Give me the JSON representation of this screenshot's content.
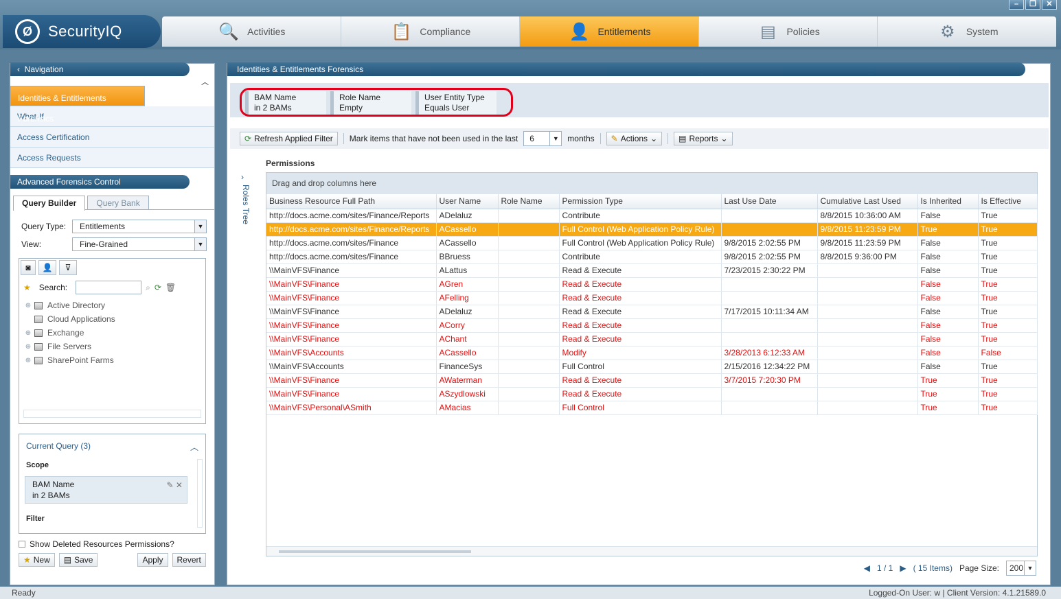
{
  "app": {
    "name": "SecurityIQ",
    "logo_letter": "Ø"
  },
  "window_controls": [
    "–",
    "❐",
    "✕"
  ],
  "tabs": [
    {
      "label": "Activities",
      "icon": "magnifier-icon"
    },
    {
      "label": "Compliance",
      "icon": "clipboard-icon"
    },
    {
      "label": "Entitlements",
      "icon": "user-icon",
      "active": true
    },
    {
      "label": "Policies",
      "icon": "policy-icon"
    },
    {
      "label": "System",
      "icon": "gear-icon"
    }
  ],
  "navigation": {
    "title": "Navigation",
    "items": [
      "Identities & Entitlements Forensics",
      "What-If",
      "Access Certification",
      "Access Requests"
    ],
    "selected_index": 0
  },
  "forensics": {
    "title": "Advanced Forensics Control",
    "tabs": [
      "Query Builder",
      "Query Bank"
    ],
    "query_type_label": "Query Type:",
    "query_type_value": "Entitlements",
    "view_label": "View:",
    "view_value": "Fine-Grained",
    "search_label": "Search:",
    "tree": [
      "Active Directory",
      "Cloud Applications",
      "Exchange",
      "File Servers",
      "SharePoint Farms"
    ],
    "current_query_label": "Current Query (3)",
    "scope_label": "Scope",
    "scope_chip_line1": "BAM Name",
    "scope_chip_line2": "in 2 BAMs",
    "filter_label": "Filter",
    "show_deleted_label": "Show Deleted Resources Permissions?",
    "buttons": {
      "new": "New",
      "save": "Save",
      "apply": "Apply",
      "revert": "Revert"
    }
  },
  "main": {
    "title": "Identities & Entitlements Forensics",
    "chips": [
      {
        "line1": "BAM Name",
        "line2": "in 2 BAMs"
      },
      {
        "line1": "Role Name",
        "line2": "Empty"
      },
      {
        "line1": "User Entity Type",
        "line2": "Equals  User"
      }
    ],
    "refresh_label": "Refresh Applied Filter",
    "mark_label": "Mark items that have not been used in the last",
    "months_value": "6",
    "months_label": "months",
    "actions_label": "Actions",
    "reports_label": "Reports",
    "roles_tree_label": "Roles Tree",
    "permissions_title": "Permissions",
    "drag_hint": "Drag and drop columns here",
    "columns": [
      "Business Resource Full Path",
      "User Name",
      "Role Name",
      "Permission Type",
      "Last Use Date",
      "Cumulative Last Used",
      "Is Inherited",
      "Is Effective"
    ],
    "rows": [
      {
        "style": "normal",
        "cells": [
          "http://docs.acme.com/sites/Finance/Reports",
          "ADelaluz",
          "",
          "Contribute",
          "",
          "8/8/2015 10:36:00 AM",
          "False",
          "True"
        ]
      },
      {
        "style": "highlight",
        "cells": [
          "http://docs.acme.com/sites/Finance/Reports",
          "ACassello",
          "",
          "Full Control (Web Application Policy Rule)",
          "",
          "9/8/2015 11:23:59 PM",
          "True",
          "True"
        ]
      },
      {
        "style": "normal",
        "cells": [
          "http://docs.acme.com/sites/Finance",
          "ACassello",
          "",
          "Full Control (Web Application Policy Rule)",
          "9/8/2015 2:02:55 PM",
          "9/8/2015 11:23:59 PM",
          "False",
          "True"
        ]
      },
      {
        "style": "normal",
        "cells": [
          "http://docs.acme.com/sites/Finance",
          "BBruess",
          "",
          "Contribute",
          "9/8/2015 2:02:55 PM",
          "8/8/2015 9:36:00 PM",
          "False",
          "True"
        ]
      },
      {
        "style": "normal",
        "cells": [
          "\\\\MainVFS\\Finance",
          "ALattus",
          "",
          "Read & Execute",
          "7/23/2015 2:30:22 PM",
          "",
          "False",
          "True"
        ]
      },
      {
        "style": "red",
        "cells": [
          "\\\\MainVFS\\Finance",
          "AGren",
          "",
          "Read & Execute",
          "",
          "",
          "False",
          "True"
        ]
      },
      {
        "style": "red",
        "cells": [
          "\\\\MainVFS\\Finance",
          "AFelling",
          "",
          "Read & Execute",
          "",
          "",
          "False",
          "True"
        ]
      },
      {
        "style": "normal",
        "cells": [
          "\\\\MainVFS\\Finance",
          "ADelaluz",
          "",
          "Read & Execute",
          "7/17/2015 10:11:34 AM",
          "",
          "False",
          "True"
        ]
      },
      {
        "style": "red",
        "cells": [
          "\\\\MainVFS\\Finance",
          "ACorry",
          "",
          "Read & Execute",
          "",
          "",
          "False",
          "True"
        ]
      },
      {
        "style": "red",
        "cells": [
          "\\\\MainVFS\\Finance",
          "AChant",
          "",
          "Read & Execute",
          "",
          "",
          "False",
          "True"
        ]
      },
      {
        "style": "red",
        "cells": [
          "\\\\MainVFS\\Accounts",
          "ACassello",
          "",
          "Modify",
          "3/28/2013 6:12:33 AM",
          "",
          "False",
          "False"
        ]
      },
      {
        "style": "normal",
        "cells": [
          "\\\\MainVFS\\Accounts",
          "FinanceSys",
          "",
          "Full Control",
          "2/15/2016 12:34:22 PM",
          "",
          "False",
          "True"
        ]
      },
      {
        "style": "red",
        "cells": [
          "\\\\MainVFS\\Finance",
          "AWaterman",
          "",
          "Read & Execute",
          "3/7/2015 7:20:30 PM",
          "",
          "True",
          "True"
        ]
      },
      {
        "style": "red",
        "cells": [
          "\\\\MainVFS\\Finance",
          "ASzydlowski",
          "",
          "Read & Execute",
          "",
          "",
          "True",
          "True"
        ]
      },
      {
        "style": "red",
        "cells": [
          "\\\\MainVFS\\Personal\\ASmith",
          "AMacias",
          "",
          "Full Control",
          "",
          "",
          "True",
          "True"
        ]
      }
    ],
    "pager": {
      "page": "1 / 1",
      "items": "( 15 Items)",
      "page_size_label": "Page Size:",
      "page_size": "200"
    }
  },
  "status": {
    "left": "Ready",
    "right": "Logged-On User: w | Client Version: 4.1.21589.0"
  }
}
